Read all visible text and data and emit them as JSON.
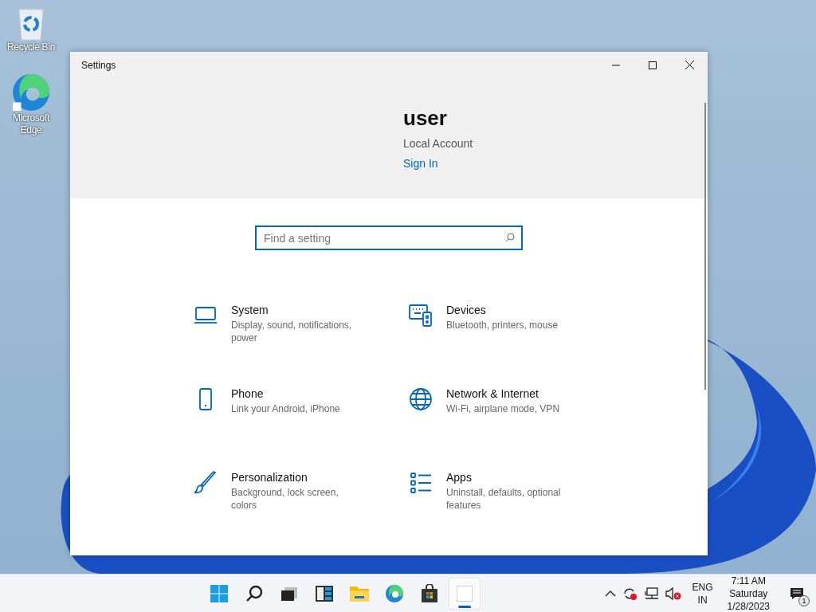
{
  "desktop_icons": [
    {
      "kind": "recycle",
      "label": "Recycle Bin"
    },
    {
      "kind": "edge",
      "label": "Microsoft Edge"
    }
  ],
  "window": {
    "title": "Settings"
  },
  "account": {
    "name": "user",
    "type": "Local Account",
    "link": "Sign In"
  },
  "search": {
    "placeholder": "Find a setting"
  },
  "categories": [
    {
      "kind": "system",
      "title": "System",
      "subtitle": "Display, sound, notifications, power"
    },
    {
      "kind": "devices",
      "title": "Devices",
      "subtitle": "Bluetooth, printers, mouse"
    },
    {
      "kind": "phone",
      "title": "Phone",
      "subtitle": "Link your Android, iPhone"
    },
    {
      "kind": "network",
      "title": "Network & Internet",
      "subtitle": "Wi-Fi, airplane mode, VPN"
    },
    {
      "kind": "personalization",
      "title": "Personalization",
      "subtitle": "Background, lock screen, colors"
    },
    {
      "kind": "apps",
      "title": "Apps",
      "subtitle": "Uninstall, defaults, optional features"
    }
  ],
  "taskbar": {
    "apps": [
      {
        "kind": "start",
        "selected": false
      },
      {
        "kind": "search",
        "selected": false
      },
      {
        "kind": "taskview",
        "selected": false
      },
      {
        "kind": "widgets",
        "selected": false
      },
      {
        "kind": "explorer",
        "selected": false
      },
      {
        "kind": "edge",
        "selected": false
      },
      {
        "kind": "store",
        "selected": false
      },
      {
        "kind": "settings",
        "selected": true
      }
    ],
    "language": {
      "line1": "ENG",
      "line2": "IN"
    },
    "clock": {
      "time": "7:11 AM",
      "day": "Saturday",
      "date": "1/28/2023"
    },
    "notification_count": "1"
  }
}
